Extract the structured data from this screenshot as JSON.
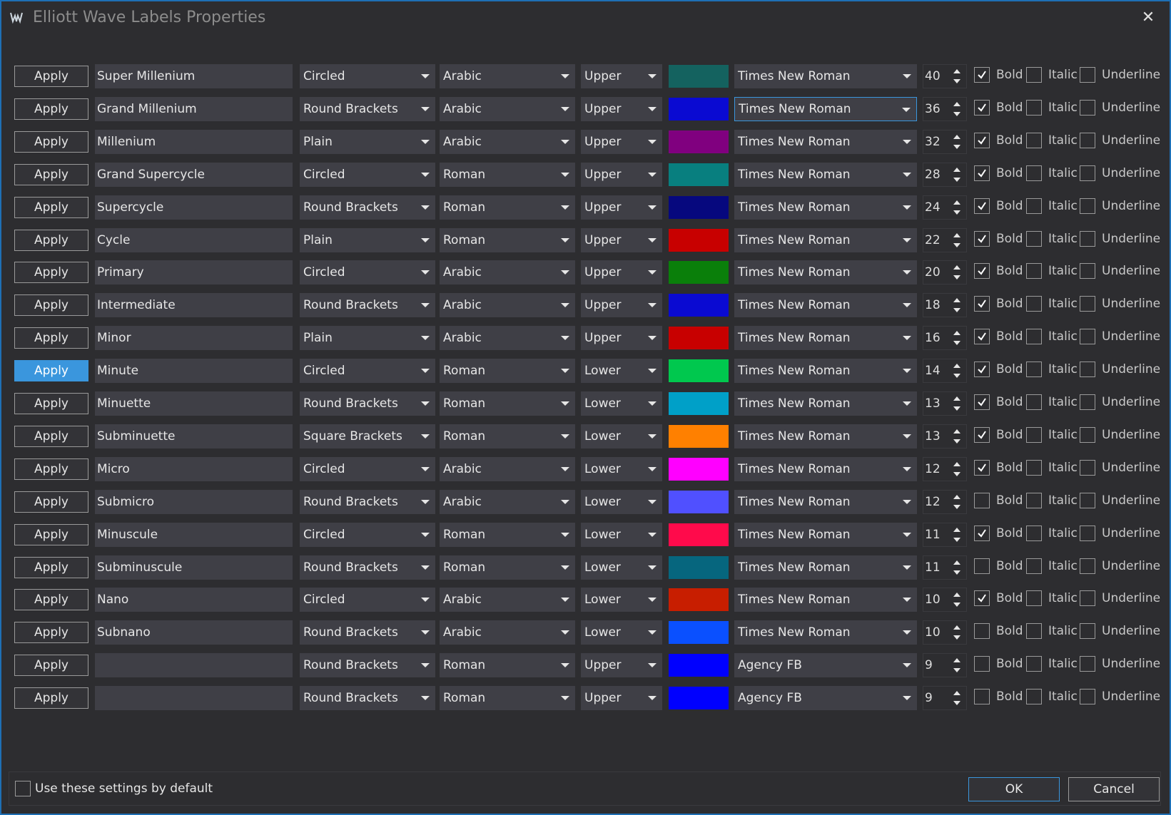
{
  "window": {
    "title": "Elliott Wave Labels Properties",
    "accent_color": "#1e6fb5",
    "close_icon": "close-icon"
  },
  "labels": {
    "apply": "Apply",
    "bold": "Bold",
    "italic": "Italic",
    "underline": "Underline"
  },
  "rows": [
    {
      "name": "Super Millenium",
      "style": "Circled",
      "numbering": "Arabic",
      "case": "Upper",
      "color": "#14625f",
      "font": "Times New Roman",
      "size": "40",
      "bold": true,
      "italic": false,
      "underline": false
    },
    {
      "name": "Grand Millenium",
      "style": "Round Brackets",
      "numbering": "Arabic",
      "case": "Upper",
      "color": "#0a0ad2",
      "font": "Times New Roman",
      "size": "36",
      "bold": true,
      "italic": false,
      "underline": false,
      "font_focused": true
    },
    {
      "name": "Millenium",
      "style": "Plain",
      "numbering": "Arabic",
      "case": "Upper",
      "color": "#80007f",
      "font": "Times New Roman",
      "size": "32",
      "bold": true,
      "italic": false,
      "underline": false
    },
    {
      "name": "Grand Supercycle",
      "style": "Circled",
      "numbering": "Roman",
      "case": "Upper",
      "color": "#087f7f",
      "font": "Times New Roman",
      "size": "28",
      "bold": true,
      "italic": false,
      "underline": false
    },
    {
      "name": "Supercycle",
      "style": "Round Brackets",
      "numbering": "Roman",
      "case": "Upper",
      "color": "#06087e",
      "font": "Times New Roman",
      "size": "24",
      "bold": true,
      "italic": false,
      "underline": false
    },
    {
      "name": "Cycle",
      "style": "Plain",
      "numbering": "Roman",
      "case": "Upper",
      "color": "#c80000",
      "font": "Times New Roman",
      "size": "22",
      "bold": true,
      "italic": false,
      "underline": false
    },
    {
      "name": "Primary",
      "style": "Circled",
      "numbering": "Arabic",
      "case": "Upper",
      "color": "#0a7f0a",
      "font": "Times New Roman",
      "size": "20",
      "bold": true,
      "italic": false,
      "underline": false
    },
    {
      "name": "Intermediate",
      "style": "Round Brackets",
      "numbering": "Arabic",
      "case": "Upper",
      "color": "#0a0ad2",
      "font": "Times New Roman",
      "size": "18",
      "bold": true,
      "italic": false,
      "underline": false
    },
    {
      "name": "Minor",
      "style": "Plain",
      "numbering": "Arabic",
      "case": "Upper",
      "color": "#c80000",
      "font": "Times New Roman",
      "size": "16",
      "bold": true,
      "italic": false,
      "underline": false
    },
    {
      "name": "Minute",
      "style": "Circled",
      "numbering": "Roman",
      "case": "Lower",
      "color": "#00c84e",
      "font": "Times New Roman",
      "size": "14",
      "bold": true,
      "italic": false,
      "underline": false,
      "apply_active": true
    },
    {
      "name": "Minuette",
      "style": "Round Brackets",
      "numbering": "Roman",
      "case": "Lower",
      "color": "#00a0c8",
      "font": "Times New Roman",
      "size": "13",
      "bold": true,
      "italic": false,
      "underline": false
    },
    {
      "name": "Subminuette",
      "style": "Square Brackets",
      "numbering": "Roman",
      "case": "Lower",
      "color": "#ff8000",
      "font": "Times New Roman",
      "size": "13",
      "bold": true,
      "italic": false,
      "underline": false
    },
    {
      "name": "Micro",
      "style": "Circled",
      "numbering": "Arabic",
      "case": "Lower",
      "color": "#ff00ff",
      "font": "Times New Roman",
      "size": "12",
      "bold": true,
      "italic": false,
      "underline": false
    },
    {
      "name": "Submicro",
      "style": "Round Brackets",
      "numbering": "Arabic",
      "case": "Lower",
      "color": "#5050ff",
      "font": "Times New Roman",
      "size": "12",
      "bold": false,
      "italic": false,
      "underline": false
    },
    {
      "name": "Minuscule",
      "style": "Circled",
      "numbering": "Roman",
      "case": "Lower",
      "color": "#ff0a4b",
      "font": "Times New Roman",
      "size": "11",
      "bold": true,
      "italic": false,
      "underline": false
    },
    {
      "name": "Subminuscule",
      "style": "Round Brackets",
      "numbering": "Roman",
      "case": "Lower",
      "color": "#06667e",
      "font": "Times New Roman",
      "size": "11",
      "bold": false,
      "italic": false,
      "underline": false
    },
    {
      "name": "Nano",
      "style": "Circled",
      "numbering": "Arabic",
      "case": "Lower",
      "color": "#c81e00",
      "font": "Times New Roman",
      "size": "10",
      "bold": true,
      "italic": false,
      "underline": false
    },
    {
      "name": "Subnano",
      "style": "Round Brackets",
      "numbering": "Arabic",
      "case": "Lower",
      "color": "#0a50ff",
      "font": "Times New Roman",
      "size": "10",
      "bold": false,
      "italic": false,
      "underline": false
    },
    {
      "name": "",
      "style": "Round Brackets",
      "numbering": "Roman",
      "case": "Upper",
      "color": "#0000ff",
      "font": "Agency FB",
      "size": "9",
      "bold": false,
      "italic": false,
      "underline": false
    },
    {
      "name": "",
      "style": "Round Brackets",
      "numbering": "Roman",
      "case": "Upper",
      "color": "#0000ff",
      "font": "Agency FB",
      "size": "9",
      "bold": false,
      "italic": false,
      "underline": false
    }
  ],
  "footer": {
    "default_label": "Use these settings by default",
    "default_checked": false,
    "ok": "OK",
    "cancel": "Cancel"
  }
}
